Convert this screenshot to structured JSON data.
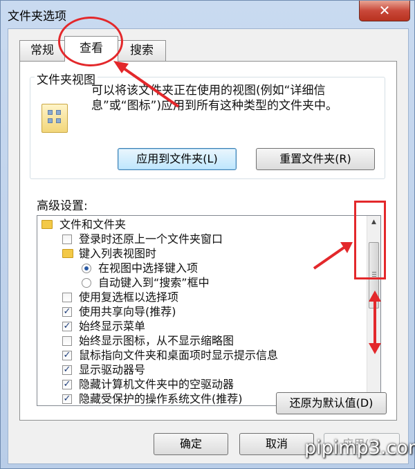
{
  "window": {
    "title": "文件夹选项",
    "close_glyph": "✕"
  },
  "tabs": [
    {
      "label": "常规",
      "active": false
    },
    {
      "label": "查看",
      "active": true
    },
    {
      "label": "搜索",
      "active": false
    }
  ],
  "folder_views": {
    "group_label": "文件夹视图",
    "description": "可以将该文件夹正在使用的视图(例如“详细信息”或“图标”)应用到所有这种类型的文件夹中。",
    "apply_button": "应用到文件夹(L)",
    "reset_button": "重置文件夹(R)"
  },
  "advanced": {
    "label": "高级设置:",
    "items": [
      {
        "kind": "folder",
        "label": "文件和文件夹"
      },
      {
        "kind": "checkbox",
        "checked": false,
        "label": "登录时还原上一个文件夹窗口"
      },
      {
        "kind": "folder",
        "label": "键入列表视图时"
      },
      {
        "kind": "radio",
        "checked": true,
        "label": "在视图中选择键入项"
      },
      {
        "kind": "radio",
        "checked": false,
        "label": "自动键入到“搜索”框中"
      },
      {
        "kind": "checkbox",
        "checked": false,
        "label": "使用复选框以选择项"
      },
      {
        "kind": "checkbox",
        "checked": true,
        "label": "使用共享向导(推荐)"
      },
      {
        "kind": "checkbox",
        "checked": true,
        "label": "始终显示菜单"
      },
      {
        "kind": "checkbox",
        "checked": false,
        "label": "始终显示图标，从不显示缩略图"
      },
      {
        "kind": "checkbox",
        "checked": true,
        "label": "鼠标指向文件夹和桌面项时显示提示信息"
      },
      {
        "kind": "checkbox",
        "checked": true,
        "label": "显示驱动器号"
      },
      {
        "kind": "checkbox",
        "checked": true,
        "label": "隐藏计算机文件夹中的空驱动器"
      },
      {
        "kind": "checkbox",
        "checked": true,
        "label": "隐藏受保护的操作系统文件(推荐)"
      }
    ],
    "restore_defaults_button": "还原为默认值(D)"
  },
  "footer": {
    "ok": "确定",
    "cancel": "取消",
    "apply": "应用(A)"
  },
  "annotations": {
    "color": "#e3282b"
  },
  "watermark": "pipimp3.com"
}
